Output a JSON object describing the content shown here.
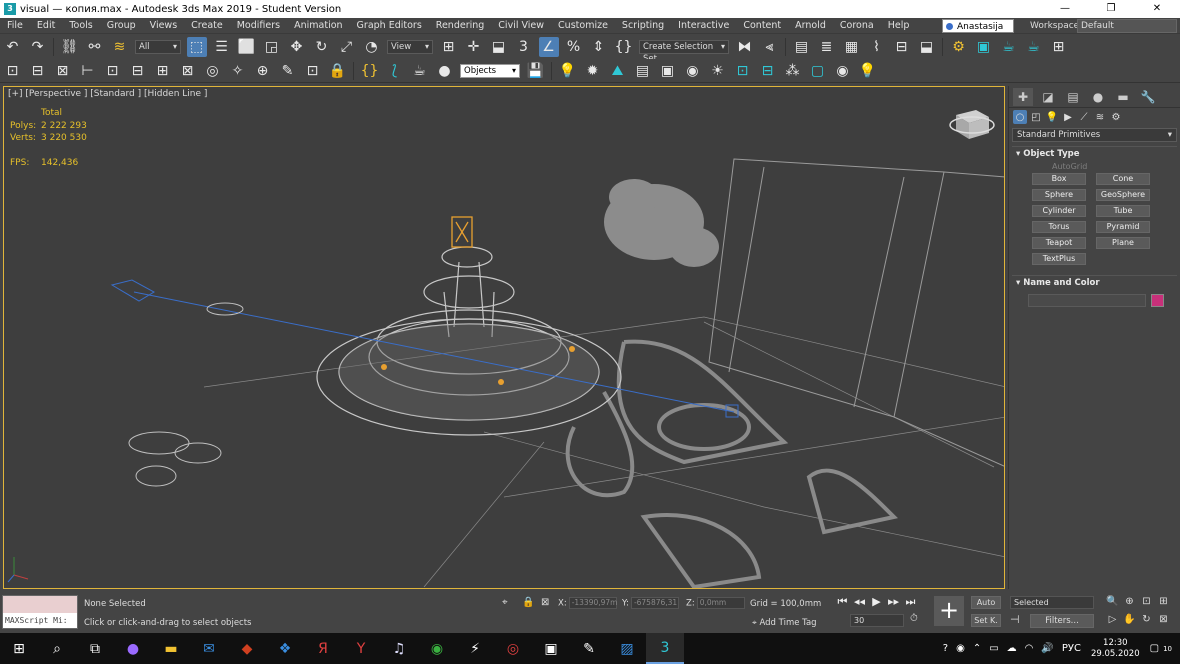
{
  "window": {
    "title": "visual — копия.max - Autodesk 3ds Max 2019 - Student Version",
    "app_icon": "3",
    "minimize": "—",
    "maximize": "❐",
    "close": "✕"
  },
  "menu": [
    "File",
    "Edit",
    "Tools",
    "Group",
    "Views",
    "Create",
    "Modifiers",
    "Animation",
    "Graph Editors",
    "Rendering",
    "Civil View",
    "Customize",
    "Scripting",
    "Interactive",
    "Content",
    "Arnold",
    "Corona",
    "Help"
  ],
  "user": "Anastasija B...",
  "workspaces": {
    "label": "Workspaces:",
    "value": "Default"
  },
  "toolbar1": {
    "filter": "All",
    "ref_coord": "View",
    "selection_set": "Create Selection Set"
  },
  "toolbar2": {
    "objects": "Objects"
  },
  "viewport": {
    "label": "[+] [Perspective ] [Standard ] [Hidden Line ]",
    "stats": {
      "total": "Total",
      "polys_label": "Polys:",
      "polys": "2 222 293",
      "verts_label": "Verts:",
      "verts": "3 220 530",
      "fps_label": "FPS:",
      "fps": "142,436"
    }
  },
  "command_panel": {
    "category": "Standard Primitives",
    "object_type_title": "Object Type",
    "autogrid": "AutoGrid",
    "buttons": [
      "Box",
      "Cone",
      "Sphere",
      "GeoSphere",
      "Cylinder",
      "Tube",
      "Torus",
      "Pyramid",
      "Teapot",
      "Plane",
      "TextPlus"
    ],
    "name_color_title": "Name and Color",
    "color": "#c8307a"
  },
  "status": {
    "selection": "None Selected",
    "prompt": "Click or click-and-drag to select objects",
    "maxscript": "MAXScript Mi:",
    "x_label": "X:",
    "x_value": "-13390,97m",
    "y_label": "Y:",
    "y_value": "-675876,31",
    "z_label": "Z:",
    "z_value": "0,0mm",
    "grid": "Grid = 100,0mm",
    "add_time_tag": "Add Time Tag",
    "frame": "30",
    "auto": "Auto",
    "setk": "Set K.",
    "selected": "Selected",
    "filters": "Filters..."
  },
  "taskbar": {
    "lang": "РУС",
    "time": "12:30",
    "date": "29.05.2020",
    "notifications": "10"
  }
}
